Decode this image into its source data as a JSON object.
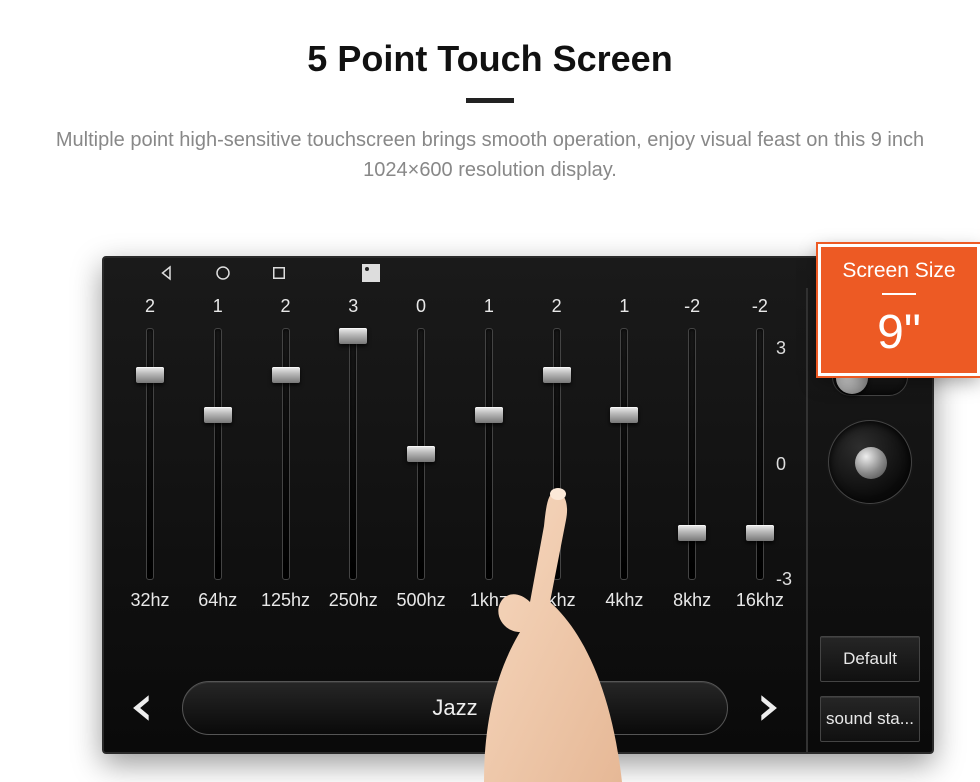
{
  "header": {
    "title": "5 Point Touch Screen",
    "subtitle": "Multiple point high-sensitive touchscreen brings smooth operation, enjoy visual feast on this 9 inch 1024×600 resolution display."
  },
  "callout": {
    "label": "Screen Size",
    "value": "9\""
  },
  "equalizer": {
    "min": -3,
    "max": 3,
    "scale_labels": [
      "3",
      "0",
      "-3"
    ],
    "bands": [
      {
        "freq": "32hz",
        "value": 2
      },
      {
        "freq": "64hz",
        "value": 1
      },
      {
        "freq": "125hz",
        "value": 2
      },
      {
        "freq": "250hz",
        "value": 3
      },
      {
        "freq": "500hz",
        "value": 0
      },
      {
        "freq": "1khz",
        "value": 1
      },
      {
        "freq": "2khz",
        "value": 2
      },
      {
        "freq": "4khz",
        "value": 1
      },
      {
        "freq": "8khz",
        "value": -2
      },
      {
        "freq": "16khz",
        "value": -2
      }
    ],
    "preset": "Jazz"
  },
  "side": {
    "toggle_on": false,
    "default_label": "Default",
    "sound_label": "sound sta..."
  },
  "colors": {
    "accent": "#ed5a24"
  }
}
